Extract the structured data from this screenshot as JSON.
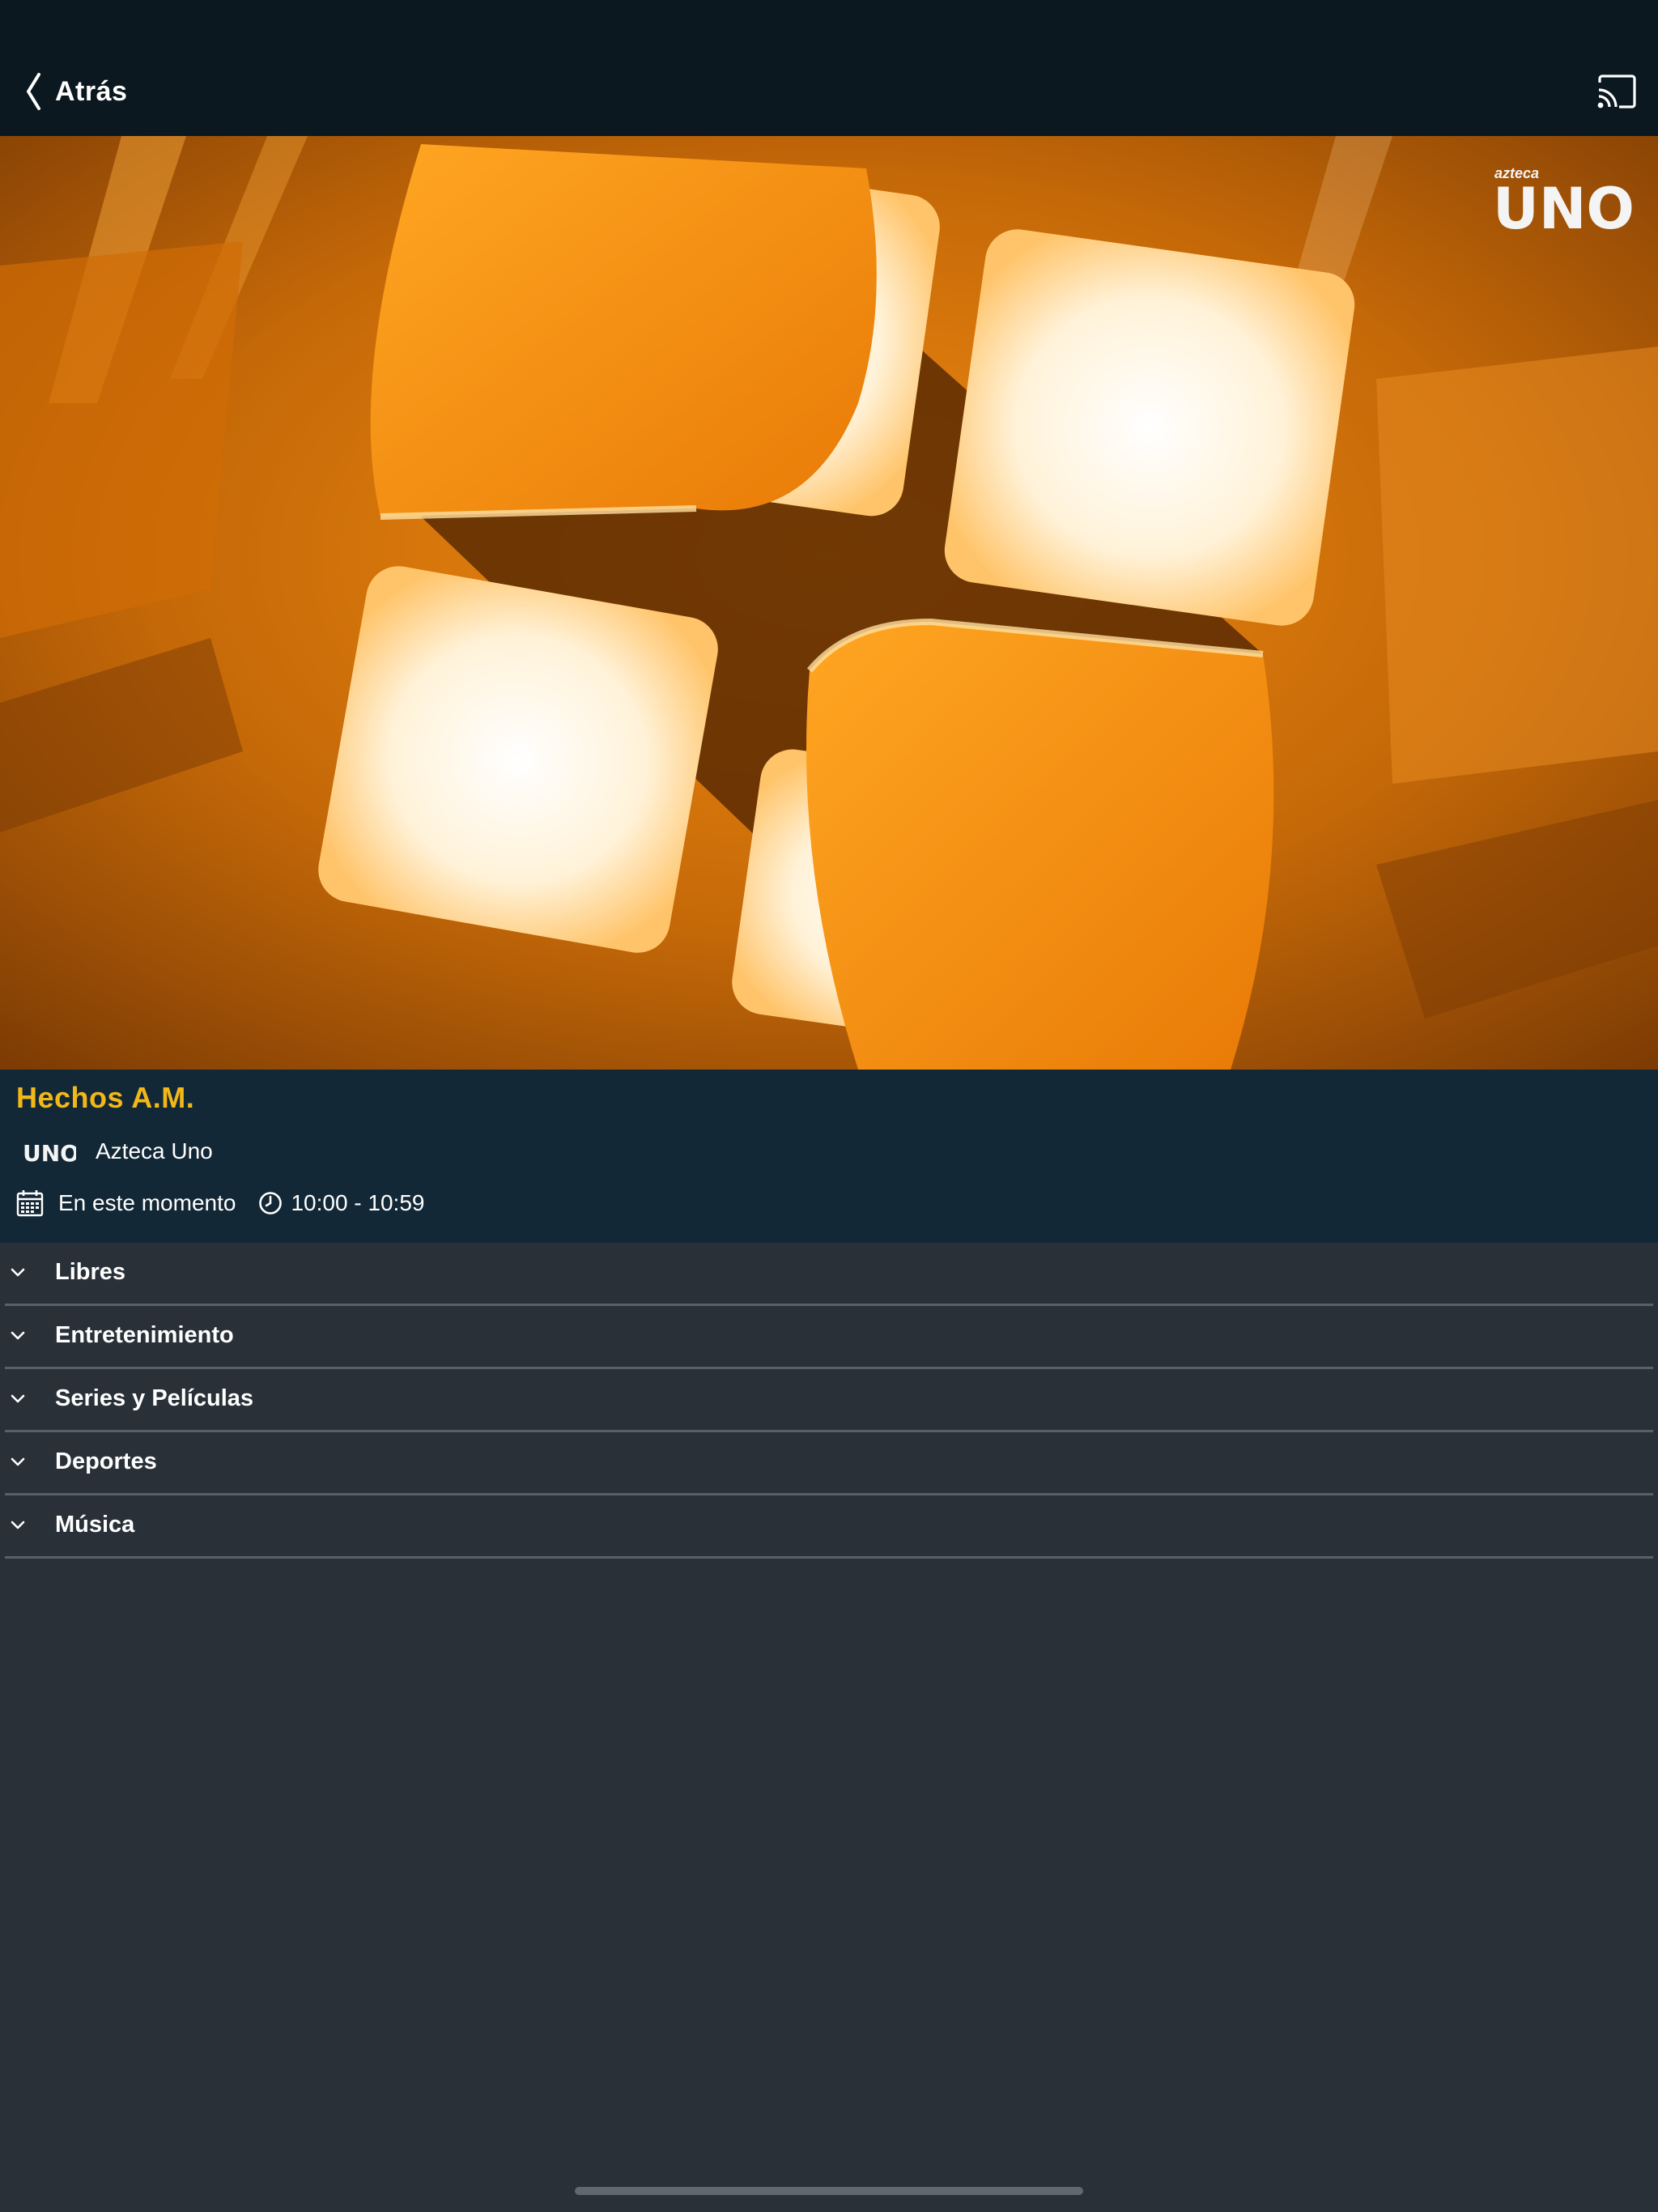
{
  "header": {
    "back_label": "Atrás",
    "back_icon": "chevron-left-icon",
    "cast_icon": "cast-icon"
  },
  "video": {
    "watermark_small": "azteca",
    "watermark_big": "UNO"
  },
  "program": {
    "title": "Hechos A.M.",
    "channel_name": "Azteca Uno",
    "channel_logo_text": "UNO",
    "date_text": "En este momento",
    "time_range": "10:00 - 10:59"
  },
  "categories": [
    {
      "label": "Libres"
    },
    {
      "label": "Entretenimiento"
    },
    {
      "label": "Series y Películas"
    },
    {
      "label": "Deportes"
    },
    {
      "label": "Música"
    }
  ],
  "colors": {
    "header_bg": "#0b1820",
    "info_bg": "#132836",
    "page_bg": "#293038",
    "title_accent": "#f2b818",
    "divider": "#5a6068"
  }
}
